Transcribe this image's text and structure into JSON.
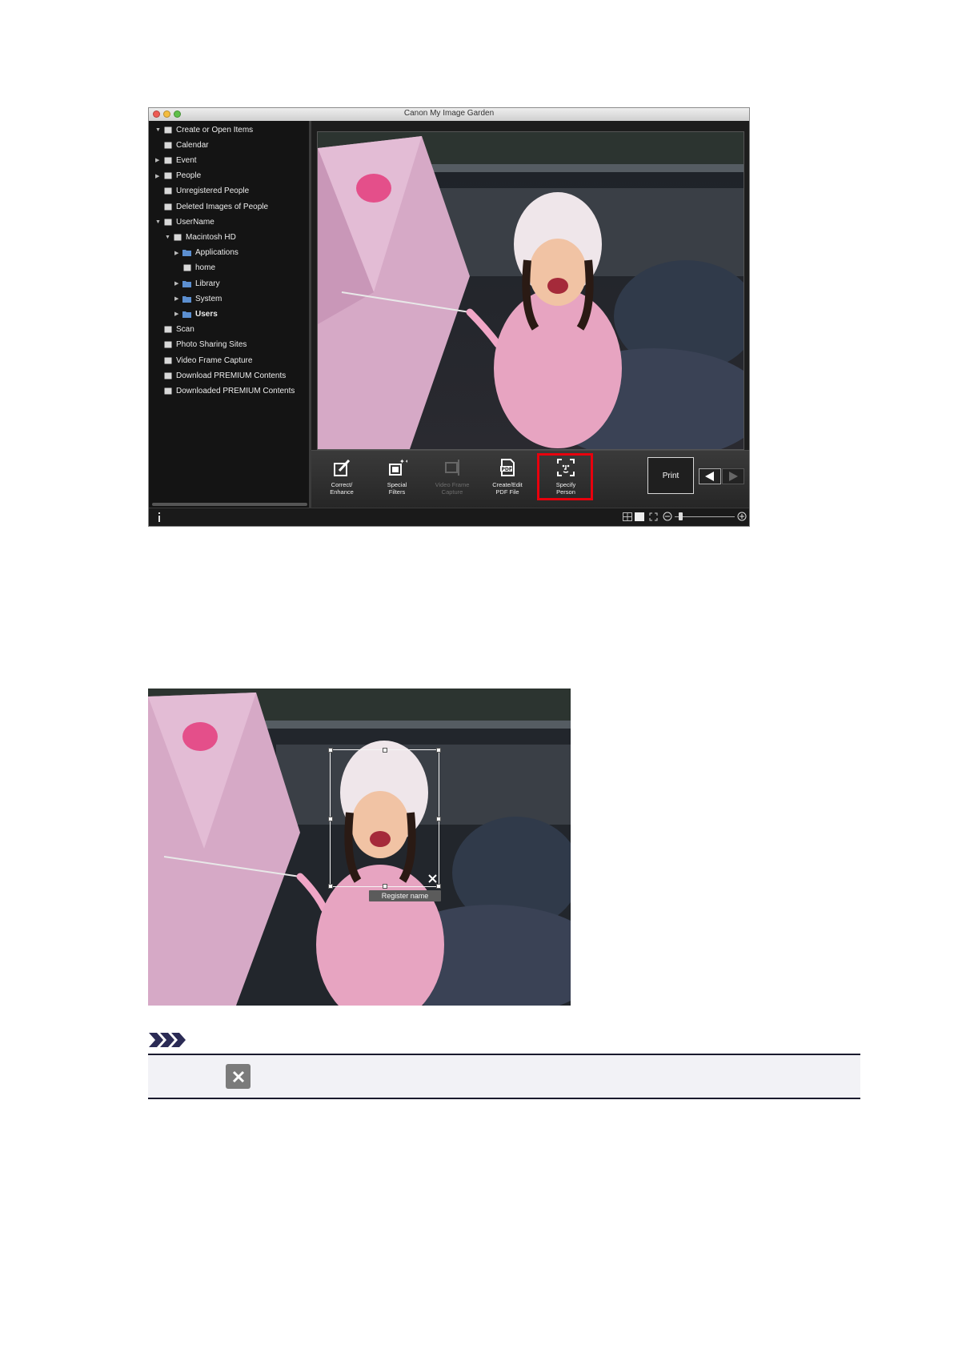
{
  "window": {
    "title": "Canon My Image Garden",
    "traffic_lights": [
      "#ee5c55",
      "#f4bd3f",
      "#5fc04a"
    ]
  },
  "sidebar": {
    "items": [
      {
        "label": "Create or Open Items",
        "icon": "create-items-icon",
        "expanded": true,
        "level": 0
      },
      {
        "label": "Calendar",
        "icon": "calendar-icon",
        "level": 0
      },
      {
        "label": "Event",
        "icon": "event-icon",
        "collapsed": true,
        "level": 0
      },
      {
        "label": "People",
        "icon": "people-icon",
        "collapsed": true,
        "level": 0
      },
      {
        "label": "Unregistered People",
        "icon": "unregistered-people-icon",
        "level": 0
      },
      {
        "label": "Deleted Images of People",
        "icon": "deleted-people-icon",
        "level": 0
      },
      {
        "label": "UserName",
        "icon": "computer-icon",
        "expanded": true,
        "level": 0
      },
      {
        "label": "Macintosh HD",
        "icon": "hard-disk-icon",
        "expanded": true,
        "level": 1
      },
      {
        "label": "Applications",
        "icon": "folder-icon",
        "collapsed": true,
        "level": 2
      },
      {
        "label": "home",
        "icon": "home-drive-icon",
        "level": 2
      },
      {
        "label": "Library",
        "icon": "folder-icon",
        "collapsed": true,
        "level": 2
      },
      {
        "label": "System",
        "icon": "folder-icon",
        "collapsed": true,
        "level": 2
      },
      {
        "label": "Users",
        "icon": "folder-icon",
        "collapsed": true,
        "level": 2,
        "bold": true
      },
      {
        "label": "Scan",
        "icon": "scan-icon",
        "level": 0
      },
      {
        "label": "Photo Sharing Sites",
        "icon": "photo-sharing-icon",
        "level": 0
      },
      {
        "label": "Video Frame Capture",
        "icon": "video-frame-icon",
        "level": 0
      },
      {
        "label": "Download PREMIUM Contents",
        "icon": "download-premium-icon",
        "level": 0
      },
      {
        "label": "Downloaded PREMIUM Contents",
        "icon": "downloaded-premium-icon",
        "level": 0
      }
    ]
  },
  "toolbar": {
    "tools": [
      {
        "line1": "Correct/",
        "line2": "Enhance",
        "icon": "correct-enhance-icon",
        "enabled": true
      },
      {
        "line1": "Special",
        "line2": "Filters",
        "icon": "special-filters-icon",
        "enabled": true
      },
      {
        "line1": "Video Frame",
        "line2": "Capture",
        "icon": "video-frame-capture-icon",
        "enabled": false
      },
      {
        "line1": "Create/Edit",
        "line2": "PDF File",
        "icon": "pdf-file-icon",
        "enabled": true
      },
      {
        "line1": "Specify",
        "line2": "Person",
        "icon": "specify-person-icon",
        "enabled": true,
        "highlighted": true
      }
    ],
    "print_label": "Print",
    "highlight_color": "#e8000d"
  },
  "statusbar": {
    "info_icon": "info-icon",
    "view_icons": [
      "thumbnail-view-icon",
      "detail-view-icon",
      "fullscreen-icon"
    ],
    "zoom": "min"
  },
  "detail": {
    "register_label": "Register name"
  },
  "note": {
    "icon": "note-icon",
    "close_icon": "close-x-icon"
  }
}
